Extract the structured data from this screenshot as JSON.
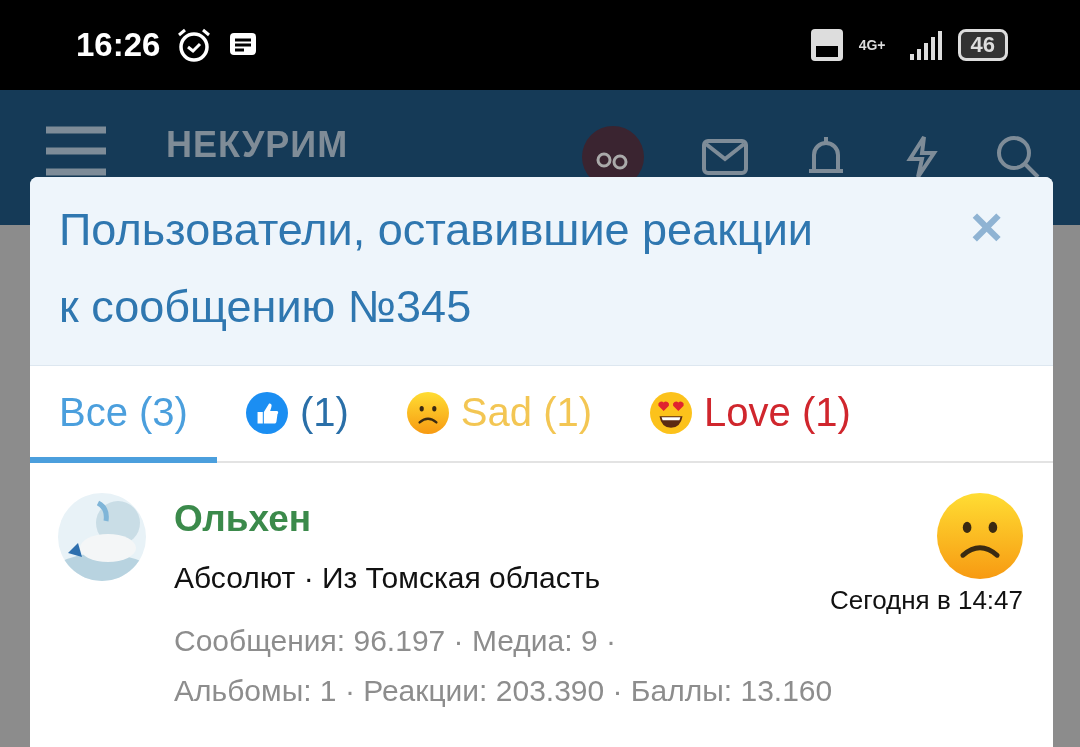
{
  "status_bar": {
    "time": "16:26",
    "network": "4G+",
    "battery": "46"
  },
  "header": {
    "logo_lines": [
      "НЕКУРИМ"
    ]
  },
  "dialog": {
    "title": "Пользователи, оставившие реакции к сообщению №345",
    "close": "×",
    "tabs": [
      {
        "kind": "all",
        "label": "Все",
        "count": "(3)",
        "color": "#4b9fdd",
        "selected": true
      },
      {
        "kind": "like",
        "count": "(1)",
        "color": "#2a6fa8",
        "selected": false
      },
      {
        "kind": "sad",
        "label": "Sad",
        "count": "(1)",
        "color": "#f3c653",
        "selected": false
      },
      {
        "kind": "love",
        "label": "Love",
        "count": "(1)",
        "color": "#d0262d",
        "selected": false
      }
    ],
    "users": [
      {
        "name": "Ольхен",
        "title": "Абсолют · Из Томская область",
        "stats": [
          "Сообщения: 96.197 · Медиа: 9 ·",
          "Альбомы: 1 · Реакции: 203.390 · Баллы: 13.160"
        ],
        "kind": "sad",
        "time": "Сегодня в 14:47"
      }
    ]
  }
}
